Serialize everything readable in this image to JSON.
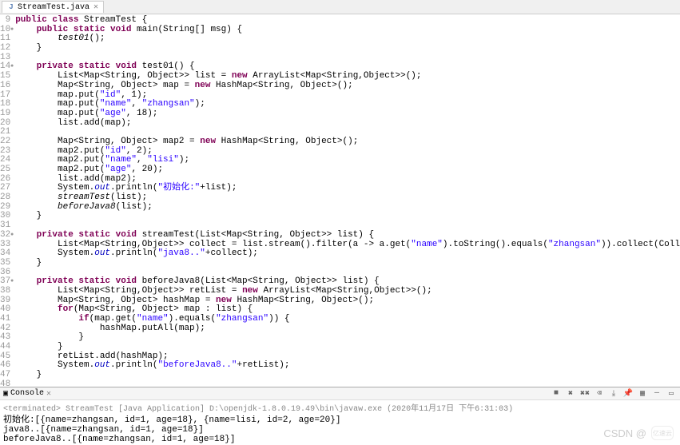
{
  "tab": {
    "label": "StreamTest.java",
    "icon": "J"
  },
  "code_lines": [
    {
      "n": 9,
      "marker": false,
      "html": "<span class='kw'>public class</span> StreamTest {"
    },
    {
      "n": 10,
      "marker": true,
      "html": "    <span class='kw'>public static void</span> main(String[] msg) {"
    },
    {
      "n": 11,
      "marker": false,
      "html": "        <span style='font-style:italic'>test01</span>();"
    },
    {
      "n": 12,
      "marker": false,
      "html": "    }"
    },
    {
      "n": 13,
      "marker": false,
      "html": ""
    },
    {
      "n": 14,
      "marker": true,
      "html": "    <span class='kw'>private static void</span> test01() {"
    },
    {
      "n": 15,
      "marker": false,
      "html": "        List&lt;Map&lt;String, Object&gt;&gt; list = <span class='kw'>new</span> ArrayList&lt;Map&lt;String,Object&gt;&gt;();"
    },
    {
      "n": 16,
      "marker": false,
      "html": "        Map&lt;String, Object&gt; map = <span class='kw'>new</span> HashMap&lt;String, Object&gt;();"
    },
    {
      "n": 17,
      "marker": false,
      "html": "        map.put(<span class='str'>\"id\"</span>, 1);"
    },
    {
      "n": 18,
      "marker": false,
      "html": "        map.put(<span class='str'>\"name\"</span>, <span class='str'>\"zhangsan\"</span>);"
    },
    {
      "n": 19,
      "marker": false,
      "html": "        map.put(<span class='str'>\"age\"</span>, 18);"
    },
    {
      "n": 20,
      "marker": false,
      "html": "        list.add(map);"
    },
    {
      "n": 21,
      "marker": false,
      "html": ""
    },
    {
      "n": 22,
      "marker": false,
      "html": "        Map&lt;String, Object&gt; map2 = <span class='kw'>new</span> HashMap&lt;String, Object&gt;();"
    },
    {
      "n": 23,
      "marker": false,
      "html": "        map2.put(<span class='str'>\"id\"</span>, 2);"
    },
    {
      "n": 24,
      "marker": false,
      "html": "        map2.put(<span class='str'>\"name\"</span>, <span class='str'>\"lisi\"</span>);"
    },
    {
      "n": 25,
      "marker": false,
      "html": "        map2.put(<span class='str'>\"age\"</span>, 20);"
    },
    {
      "n": 26,
      "marker": false,
      "html": "        list.add(map2);"
    },
    {
      "n": 27,
      "marker": false,
      "html": "        System.<span class='fld'>out</span>.println(<span class='str'>\"初始化:\"</span>+list);"
    },
    {
      "n": 28,
      "marker": false,
      "html": "        <span style='font-style:italic'>streamTest</span>(list);"
    },
    {
      "n": 29,
      "marker": false,
      "html": "        <span style='font-style:italic'>beforeJava8</span>(list);"
    },
    {
      "n": 30,
      "marker": false,
      "html": "    }"
    },
    {
      "n": 31,
      "marker": false,
      "html": ""
    },
    {
      "n": 32,
      "marker": true,
      "html": "    <span class='kw'>private static void</span> streamTest(List&lt;Map&lt;String, Object&gt;&gt; list) {"
    },
    {
      "n": 33,
      "marker": false,
      "html": "        List&lt;Map&lt;String,Object&gt;&gt; collect = list.stream().filter(a -&gt; a.get(<span class='str'>\"name\"</span>).toString().equals(<span class='str'>\"zhangsan\"</span>)).collect(Collectors.<span style='font-style:italic'>toList</span>());"
    },
    {
      "n": 34,
      "marker": false,
      "html": "        System.<span class='fld'>out</span>.println(<span class='str'>\"java8..\"</span>+collect);"
    },
    {
      "n": 35,
      "marker": false,
      "html": "    }"
    },
    {
      "n": 36,
      "marker": false,
      "html": ""
    },
    {
      "n": 37,
      "marker": true,
      "html": "    <span class='kw'>private static void</span> beforeJava8(List&lt;Map&lt;String, Object&gt;&gt; list) {"
    },
    {
      "n": 38,
      "marker": false,
      "html": "        List&lt;Map&lt;String,Object&gt;&gt; retList = <span class='kw'>new</span> ArrayList&lt;Map&lt;String,Object&gt;&gt;();"
    },
    {
      "n": 39,
      "marker": false,
      "html": "        Map&lt;String, Object&gt; hashMap = <span class='kw'>new</span> HashMap&lt;String, Object&gt;();"
    },
    {
      "n": 40,
      "marker": false,
      "html": "        <span class='kw'>for</span>(Map&lt;String, Object&gt; map : list) {"
    },
    {
      "n": 41,
      "marker": false,
      "html": "            <span class='kw'>if</span>(map.get(<span class='str'>\"name\"</span>).equals(<span class='str'>\"zhangsan\"</span>)) {"
    },
    {
      "n": 42,
      "marker": false,
      "html": "                hashMap.putAll(map);"
    },
    {
      "n": 43,
      "marker": false,
      "html": "            }"
    },
    {
      "n": 44,
      "marker": false,
      "html": "        }"
    },
    {
      "n": 45,
      "marker": false,
      "html": "        retList.add(hashMap);"
    },
    {
      "n": 46,
      "marker": false,
      "html": "        System.<span class='fld'>out</span>.println(<span class='str'>\"beforeJava8..\"</span>+retList);"
    },
    {
      "n": 47,
      "marker": false,
      "html": "    }"
    },
    {
      "n": 48,
      "marker": false,
      "html": ""
    }
  ],
  "console": {
    "title": "Console",
    "sub": "<terminated> StreamTest [Java Application] D:\\openjdk-1.8.0.19.49\\bin\\javaw.exe (2020年11月17日 下午6:31:03)",
    "lines": [
      "初始化:[{name=zhangsan, id=1, age=18}, {name=lisi, id=2, age=20}]",
      "java8..[{name=zhangsan, id=1, age=18}]",
      "beforeJava8..[{name=zhangsan, id=1, age=18}]"
    ],
    "toolbar_icons": [
      "terminate",
      "remove",
      "remove-all",
      "clear",
      "scroll-lock",
      "pin",
      "display",
      "min",
      "max"
    ]
  },
  "watermark": {
    "text": "CSDN @",
    "logo": "亿速云"
  }
}
